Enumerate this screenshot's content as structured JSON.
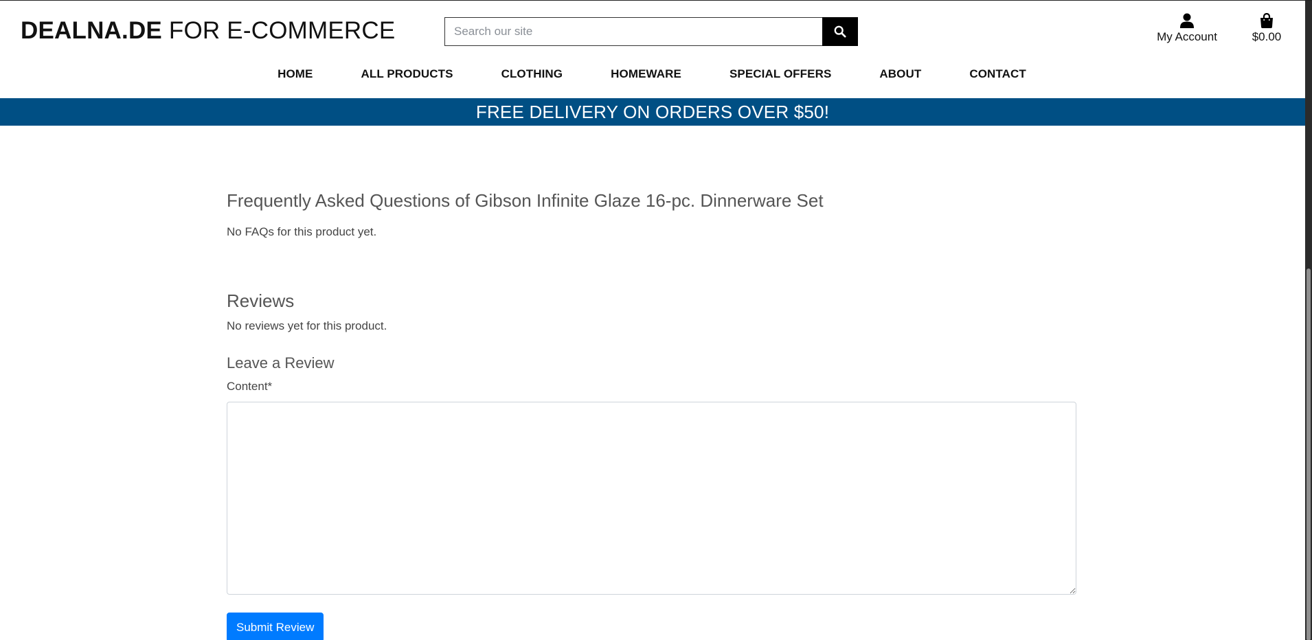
{
  "header": {
    "logo_bold": "DEALNA.DE",
    "logo_light": " FOR E-COMMERCE",
    "search_placeholder": "Search our site",
    "account_label": "My Account",
    "cart_total": "$0.00"
  },
  "nav": {
    "items": [
      {
        "label": "HOME"
      },
      {
        "label": "ALL PRODUCTS"
      },
      {
        "label": "CLOTHING"
      },
      {
        "label": "HOMEWARE"
      },
      {
        "label": "SPECIAL OFFERS"
      },
      {
        "label": "ABOUT"
      },
      {
        "label": "CONTACT"
      }
    ]
  },
  "banner": {
    "text": "FREE DELIVERY ON ORDERS OVER $50!",
    "color": "#004f84"
  },
  "faq": {
    "title": "Frequently Asked Questions of Gibson Infinite Glaze 16-pc. Dinnerware Set",
    "empty_text": "No FAQs for this product yet."
  },
  "reviews": {
    "title": "Reviews",
    "empty_text": "No reviews yet for this product.",
    "form_title": "Leave a Review",
    "content_label": "Content*",
    "content_value": "",
    "submit_label": "Submit Review",
    "submit_color": "#007bff"
  },
  "icons": {
    "search": "search-icon",
    "account": "user-icon",
    "cart": "shopping-bag-icon"
  }
}
